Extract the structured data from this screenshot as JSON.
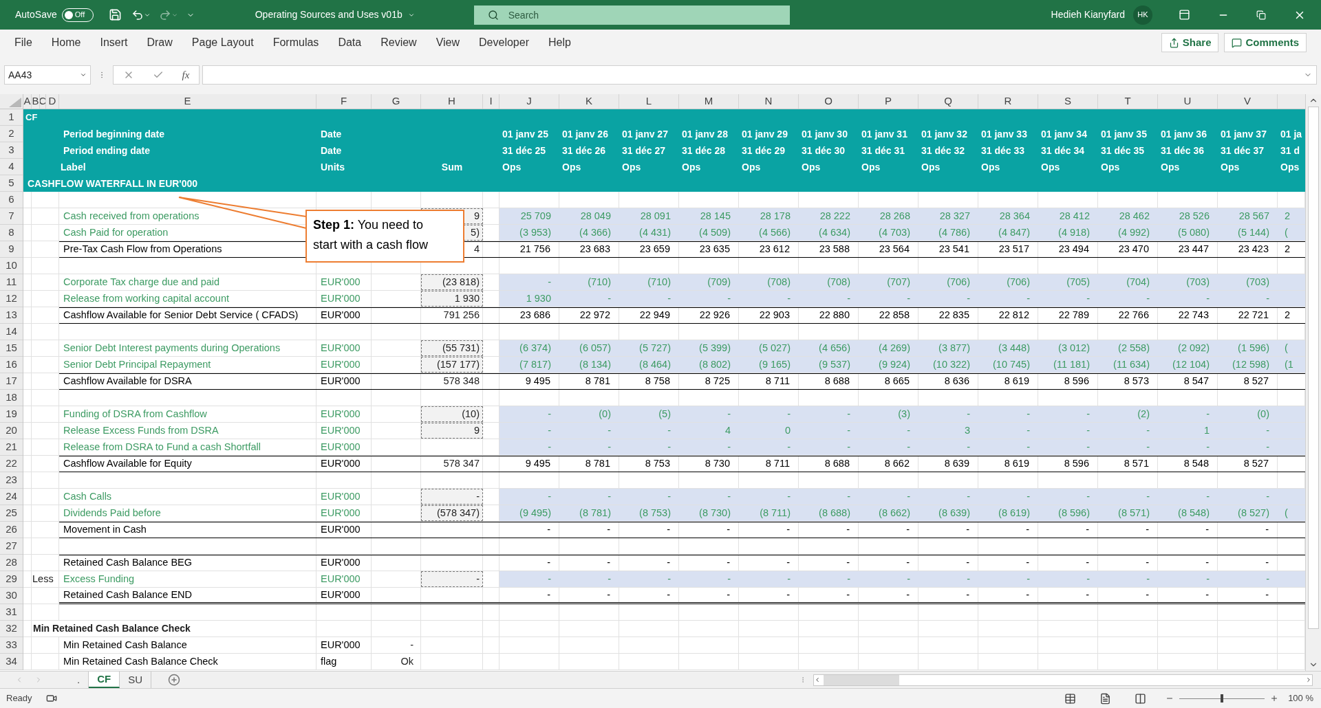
{
  "title_bar": {
    "autosave_label": "AutoSave",
    "autosave": {
      "on": false,
      "label": "Off"
    },
    "document_title": "Operating Sources and Uses v01b",
    "search": {
      "placeholder": "Search"
    },
    "user_name": "Hedieh Kianyfard",
    "user_initials": "HK"
  },
  "menu": {
    "items": [
      {
        "label": "File"
      },
      {
        "label": "Home"
      },
      {
        "label": "Insert"
      },
      {
        "label": "Draw"
      },
      {
        "label": "Page Layout"
      },
      {
        "label": "Formulas"
      },
      {
        "label": "Data"
      },
      {
        "label": "Review"
      },
      {
        "label": "View"
      },
      {
        "label": "Developer"
      },
      {
        "label": "Help"
      }
    ],
    "share": "Share",
    "comments": "Comments"
  },
  "formula_bar": {
    "name_box": "AA43",
    "function_label": "fx"
  },
  "columns": [
    "A",
    "B",
    "C",
    "D",
    "E",
    "F",
    "G",
    "H",
    "I",
    "J",
    "K",
    "L",
    "M",
    "N",
    "O",
    "P",
    "Q",
    "R",
    "S",
    "T",
    "U",
    "V"
  ],
  "rows": [
    {
      "n": "1",
      "kind": "title",
      "label": "CF"
    },
    {
      "n": "2",
      "kind": "header",
      "label": "Period beginning date",
      "unit": "Date",
      "values": [
        "01 janv 25",
        "01 janv 26",
        "01 janv 27",
        "01 janv 28",
        "01 janv 29",
        "01 janv 30",
        "01 janv 31",
        "01 janv 32",
        "01 janv 33",
        "01 janv 34",
        "01 janv 35",
        "01 janv 36",
        "01 janv 37"
      ],
      "w": "01 ja"
    },
    {
      "n": "3",
      "kind": "header",
      "label": "Period ending date",
      "unit": "Date",
      "values": [
        "31 déc 25",
        "31 déc 26",
        "31 déc 27",
        "31 déc 28",
        "31 déc 29",
        "31 déc 30",
        "31 déc 31",
        "31 déc 32",
        "31 déc 33",
        "31 déc 34",
        "31 déc 35",
        "31 déc 36",
        "31 déc 37"
      ],
      "w": "31 d"
    },
    {
      "n": "4",
      "kind": "header",
      "label": "Label",
      "unit": "Units",
      "sum": "Sum",
      "values": [
        "Ops",
        "Ops",
        "Ops",
        "Ops",
        "Ops",
        "Ops",
        "Ops",
        "Ops",
        "Ops",
        "Ops",
        "Ops",
        "Ops",
        "Ops"
      ],
      "w": "Ops"
    },
    {
      "n": "5",
      "kind": "section",
      "label": "CASHFLOW WATERFALL IN EUR'000"
    },
    {
      "n": "6",
      "kind": "blank"
    },
    {
      "n": "7",
      "kind": "input",
      "label": "Cash received from operations",
      "sum": "9",
      "values": [
        "25 709",
        "28 049",
        "28 091",
        "28 145",
        "28 178",
        "28 222",
        "28 268",
        "28 327",
        "28 364",
        "28 412",
        "28 462",
        "28 526",
        "28 567"
      ],
      "w": "2"
    },
    {
      "n": "8",
      "kind": "input",
      "label": "Cash Paid for operation",
      "sum": "5)",
      "values": [
        "(3 953)",
        "(4 366)",
        "(4 431)",
        "(4 509)",
        "(4 566)",
        "(4 634)",
        "(4 703)",
        "(4 786)",
        "(4 847)",
        "(4 918)",
        "(4 992)",
        "(5 080)",
        "(5 144)"
      ],
      "w": "("
    },
    {
      "n": "9",
      "kind": "total",
      "label": "Pre-Tax Cash Flow from Operations",
      "sum": "4",
      "values": [
        "21 756",
        "23 683",
        "23 659",
        "23 635",
        "23 612",
        "23 588",
        "23 564",
        "23 541",
        "23 517",
        "23 494",
        "23 470",
        "23 447",
        "23 423"
      ],
      "w": "2"
    },
    {
      "n": "10",
      "kind": "blank"
    },
    {
      "n": "11",
      "kind": "input",
      "label": "Corporate Tax charge due and paid",
      "unit": "EUR'000",
      "sum": "(23 818)",
      "values": [
        "-",
        "(710)",
        "(710)",
        "(709)",
        "(708)",
        "(708)",
        "(707)",
        "(706)",
        "(706)",
        "(705)",
        "(704)",
        "(703)",
        "(703)"
      ]
    },
    {
      "n": "12",
      "kind": "input",
      "label": "Release from working capital account",
      "unit": "EUR'000",
      "sum": "1 930",
      "values": [
        "1 930",
        "-",
        "-",
        "-",
        "-",
        "-",
        "-",
        "-",
        "-",
        "-",
        "-",
        "-",
        "-"
      ]
    },
    {
      "n": "13",
      "kind": "total",
      "label": "Cashflow Available for Senior Debt Service ( CFADS)",
      "unit": "EUR'000",
      "sum": "791 256",
      "values": [
        "23 686",
        "22 972",
        "22 949",
        "22 926",
        "22 903",
        "22 880",
        "22 858",
        "22 835",
        "22 812",
        "22 789",
        "22 766",
        "22 743",
        "22 721"
      ],
      "w": "2"
    },
    {
      "n": "14",
      "kind": "blank"
    },
    {
      "n": "15",
      "kind": "input",
      "label": "Senior Debt  Interest payments during Operations",
      "unit": "EUR'000",
      "sum": "(55 731)",
      "values": [
        "(6 374)",
        "(6 057)",
        "(5 727)",
        "(5 399)",
        "(5 027)",
        "(4 656)",
        "(4 269)",
        "(3 877)",
        "(3 448)",
        "(3 012)",
        "(2 558)",
        "(2 092)",
        "(1 596)"
      ],
      "w": "("
    },
    {
      "n": "16",
      "kind": "input",
      "label": "Senior Debt  Principal Repayment",
      "unit": "EUR'000",
      "sum": "(157 177)",
      "values": [
        "(7 817)",
        "(8 134)",
        "(8 464)",
        "(8 802)",
        "(9 165)",
        "(9 537)",
        "(9 924)",
        "(10 322)",
        "(10 745)",
        "(11 181)",
        "(11 634)",
        "(12 104)",
        "(12 598)"
      ],
      "w": "(1"
    },
    {
      "n": "17",
      "kind": "total",
      "label": "Cashflow Available for DSRA",
      "unit": "EUR'000",
      "sum": "578 348",
      "values": [
        "9 495",
        "8 781",
        "8 758",
        "8 725",
        "8 711",
        "8 688",
        "8 665",
        "8 636",
        "8 619",
        "8 596",
        "8 573",
        "8 547",
        "8 527"
      ]
    },
    {
      "n": "18",
      "kind": "blank"
    },
    {
      "n": "19",
      "kind": "input",
      "label": "Funding of DSRA from Cashflow",
      "unit": "EUR'000",
      "sum": "(10)",
      "values": [
        "-",
        "(0)",
        "(5)",
        "-",
        "-",
        "-",
        "(3)",
        "-",
        "-",
        "-",
        "(2)",
        "-",
        "(0)"
      ]
    },
    {
      "n": "20",
      "kind": "input",
      "label": "Release Excess Funds from DSRA",
      "unit": "EUR'000",
      "sum": "9",
      "values": [
        "-",
        "-",
        "-",
        "4",
        "0",
        "-",
        "-",
        "3",
        "-",
        "-",
        "-",
        "1",
        "-"
      ]
    },
    {
      "n": "21",
      "kind": "input",
      "label": "Release from DSRA to Fund a cash Shortfall",
      "unit": "EUR'000",
      "values": [
        "-",
        "-",
        "-",
        "-",
        "-",
        "-",
        "-",
        "-",
        "-",
        "-",
        "-",
        "-",
        "-"
      ]
    },
    {
      "n": "22",
      "kind": "total",
      "label": "Cashflow Available for Equity",
      "unit": "EUR'000",
      "sum": "578 347",
      "values": [
        "9 495",
        "8 781",
        "8 753",
        "8 730",
        "8 711",
        "8 688",
        "8 662",
        "8 639",
        "8 619",
        "8 596",
        "8 571",
        "8 548",
        "8 527"
      ]
    },
    {
      "n": "23",
      "kind": "blank"
    },
    {
      "n": "24",
      "kind": "input",
      "label": "Cash Calls",
      "unit": "EUR'000",
      "sum": "-",
      "values": [
        "-",
        "-",
        "-",
        "-",
        "-",
        "-",
        "-",
        "-",
        "-",
        "-",
        "-",
        "-",
        "-"
      ]
    },
    {
      "n": "25",
      "kind": "input",
      "label": "Dividends Paid before",
      "unit": "EUR'000",
      "sum": "(578 347)",
      "values": [
        "(9 495)",
        "(8 781)",
        "(8 753)",
        "(8 730)",
        "(8 711)",
        "(8 688)",
        "(8 662)",
        "(8 639)",
        "(8 619)",
        "(8 596)",
        "(8 571)",
        "(8 548)",
        "(8 527)"
      ],
      "w": "("
    },
    {
      "n": "26",
      "kind": "total",
      "label": "Movement in Cash",
      "unit": "EUR'000",
      "values": [
        "-",
        "-",
        "-",
        "-",
        "-",
        "-",
        "-",
        "-",
        "-",
        "-",
        "-",
        "-",
        "-"
      ]
    },
    {
      "n": "27",
      "kind": "blank"
    },
    {
      "n": "28",
      "kind": "balance",
      "label": "Retained Cash Balance BEG",
      "unit": "EUR'000",
      "values": [
        "-",
        "-",
        "-",
        "-",
        "-",
        "-",
        "-",
        "-",
        "-",
        "-",
        "-",
        "-",
        "-"
      ]
    },
    {
      "n": "29",
      "kind": "input",
      "prefix": "Less",
      "label": "Excess Funding",
      "unit": "EUR'000",
      "sum": "-",
      "values": [
        "-",
        "-",
        "-",
        "-",
        "-",
        "-",
        "-",
        "-",
        "-",
        "-",
        "-",
        "-",
        "-"
      ]
    },
    {
      "n": "30",
      "kind": "closing",
      "label": "Retained Cash Balance END",
      "unit": "EUR'000",
      "values": [
        "-",
        "-",
        "-",
        "-",
        "-",
        "-",
        "-",
        "-",
        "-",
        "-",
        "-",
        "-",
        "-"
      ]
    },
    {
      "n": "31",
      "kind": "blank"
    },
    {
      "n": "32",
      "kind": "heading",
      "label": "Min Retained Cash Balance Check"
    },
    {
      "n": "33",
      "kind": "plain",
      "label": "Min Retained Cash Balance",
      "unit": "EUR'000",
      "g": "-"
    },
    {
      "n": "34",
      "kind": "plain",
      "label": "Min Retained Cash Balance Check",
      "unit": "flag",
      "g": "Ok"
    }
  ],
  "callout": {
    "text": "**Step 1:** You need to start with a cash flow"
  },
  "sheet_tabs": [
    {
      "label": ".",
      "selected": false
    },
    {
      "label": "CF",
      "selected": true
    },
    {
      "label": "SU",
      "selected": false
    }
  ],
  "status_bar": {
    "status": "Ready",
    "zoom": {
      "level": 0.5,
      "label": "100 %"
    }
  }
}
